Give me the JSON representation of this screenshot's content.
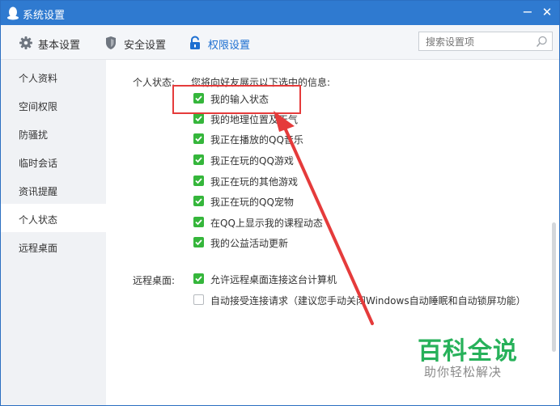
{
  "window": {
    "title": "系统设置",
    "minimize": "−",
    "close": "✕"
  },
  "toolbar": {
    "tabs": [
      {
        "label": "基本设置",
        "icon": "gear-icon"
      },
      {
        "label": "安全设置",
        "icon": "shield-icon"
      },
      {
        "label": "权限设置",
        "icon": "lock-icon",
        "active": true
      }
    ],
    "search_placeholder": "搜索设置项"
  },
  "sidebar": {
    "items": [
      {
        "label": "个人资料"
      },
      {
        "label": "空间权限"
      },
      {
        "label": "防骚扰"
      },
      {
        "label": "临时会话"
      },
      {
        "label": "资讯提醒"
      },
      {
        "label": "个人状态",
        "active": true
      },
      {
        "label": "远程桌面"
      }
    ]
  },
  "content": {
    "status_group": {
      "label": "个人状态:",
      "description": "您将向好友展示以下选中的信息:",
      "options": [
        {
          "label": "我的输入状态",
          "checked": true
        },
        {
          "label": "我的地理位置及天气",
          "checked": true
        },
        {
          "label": "我正在播放的QQ音乐",
          "checked": true
        },
        {
          "label": "我正在玩的QQ游戏",
          "checked": true
        },
        {
          "label": "我正在玩的其他游戏",
          "checked": true
        },
        {
          "label": "我正在玩的QQ宠物",
          "checked": true
        },
        {
          "label": "在QQ上显示我的课程动态",
          "checked": true
        },
        {
          "label": "我的公益活动更新",
          "checked": true
        }
      ]
    },
    "remote_group": {
      "label": "远程桌面:",
      "options": [
        {
          "label": "允许远程桌面连接这台计算机",
          "checked": true
        },
        {
          "label": "自动接受连接请求（建议您手动关闭Windows自动睡眠和自动锁屏功能）",
          "checked": false
        }
      ]
    }
  },
  "watermark": {
    "title": "百科全说",
    "subtitle": "助你轻松解决"
  },
  "colors": {
    "titlebar": "#2f7ad0",
    "accent": "#1d6fd1",
    "checkbox": "#35b63b",
    "annotation": "#e53b3b",
    "watermark": "#27b15a"
  }
}
